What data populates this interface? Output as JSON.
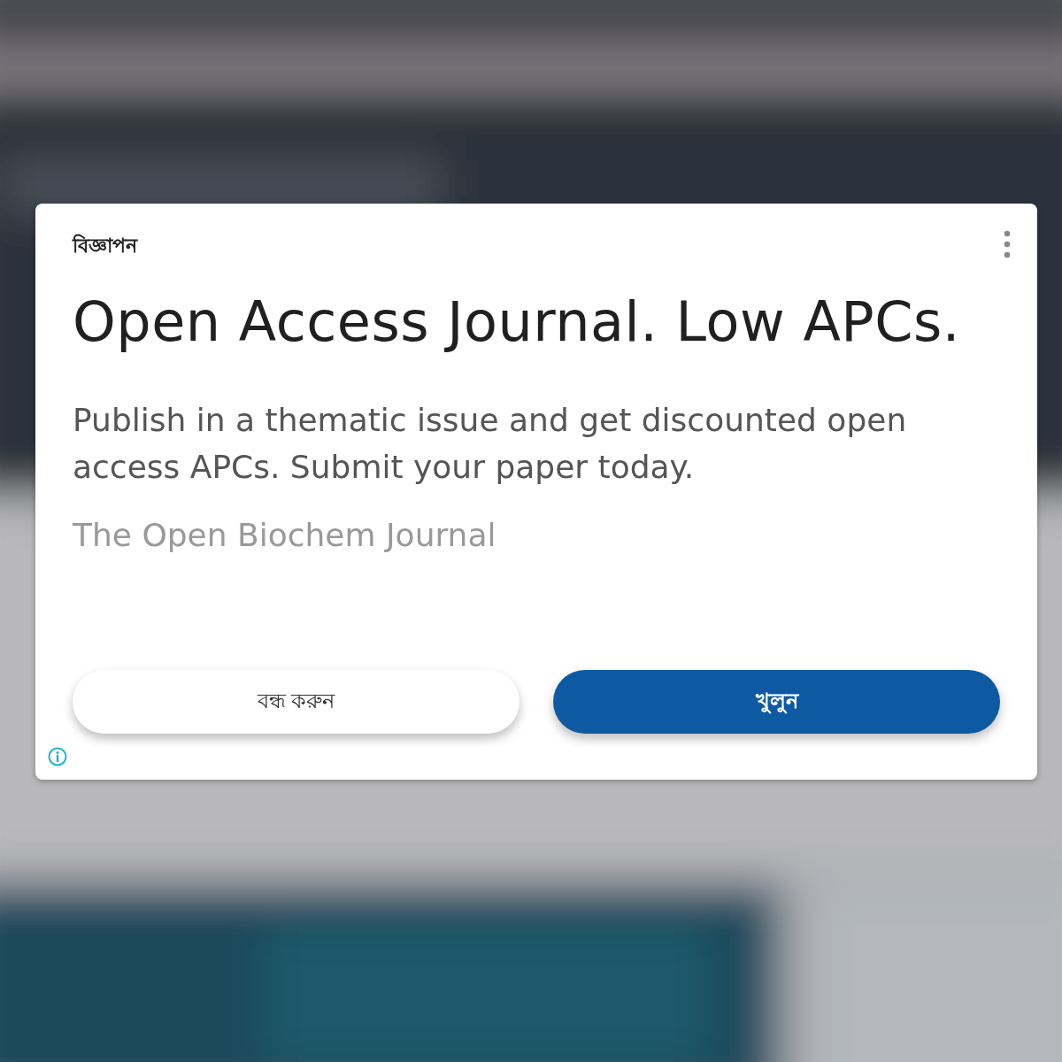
{
  "ad_label": "বিজ্ঞাপন",
  "headline": "Open Access Journal. Low APCs.",
  "body": "Publish in a thematic issue and get discounted open access APCs. Submit your paper today.",
  "advertiser": "The Open Biochem Journal",
  "buttons": [
    {
      "label": "বন্ধ করুন",
      "kind": "secondary"
    },
    {
      "label": "খুলুন",
      "kind": "primary"
    }
  ]
}
